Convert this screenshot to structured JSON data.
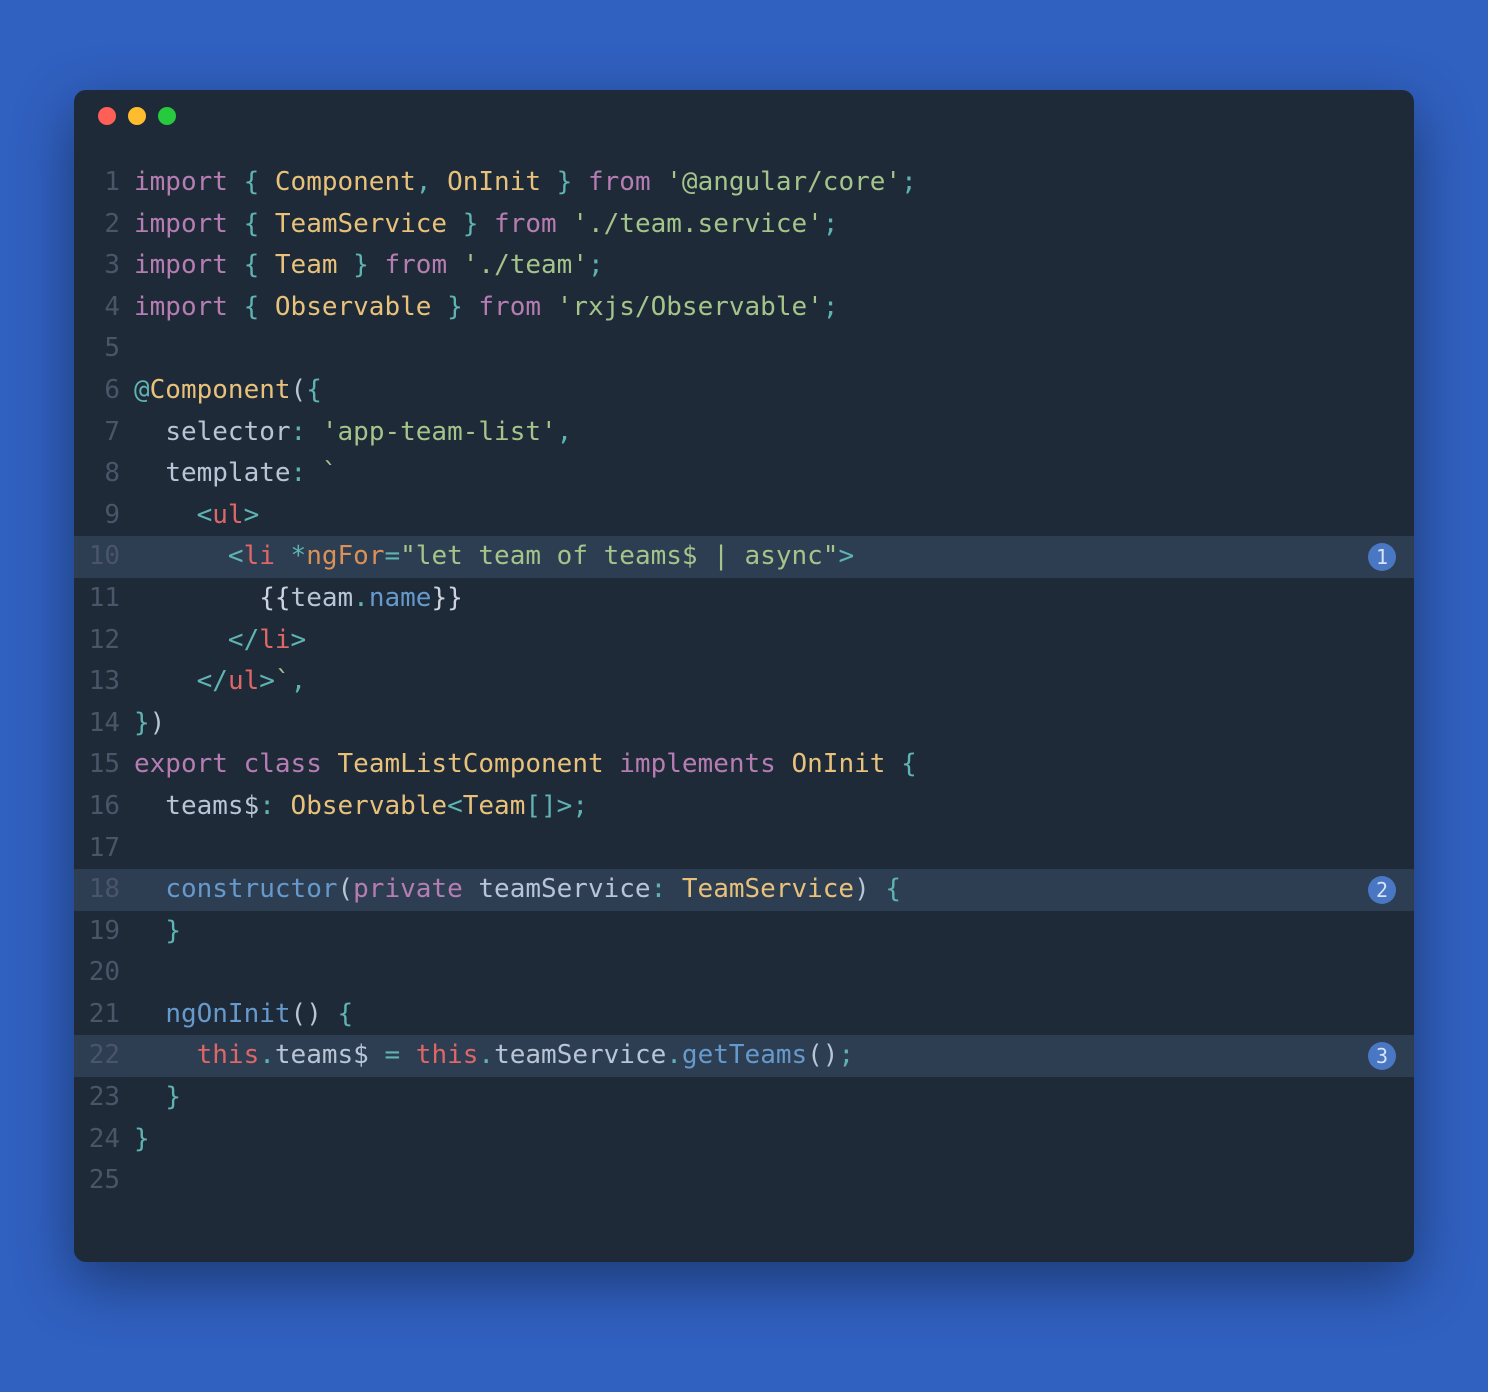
{
  "lines": [
    {
      "num": "1",
      "highlighted": false,
      "badge": null,
      "tokens": [
        {
          "cls": "tok-keyword",
          "text": "import"
        },
        {
          "cls": "tok-default",
          "text": " "
        },
        {
          "cls": "tok-punct",
          "text": "{"
        },
        {
          "cls": "tok-default",
          "text": " "
        },
        {
          "cls": "tok-type",
          "text": "Component"
        },
        {
          "cls": "tok-punct",
          "text": ","
        },
        {
          "cls": "tok-default",
          "text": " "
        },
        {
          "cls": "tok-type",
          "text": "OnInit"
        },
        {
          "cls": "tok-default",
          "text": " "
        },
        {
          "cls": "tok-punct",
          "text": "}"
        },
        {
          "cls": "tok-default",
          "text": " "
        },
        {
          "cls": "tok-keyword",
          "text": "from"
        },
        {
          "cls": "tok-default",
          "text": " "
        },
        {
          "cls": "tok-string",
          "text": "'@angular/core'"
        },
        {
          "cls": "tok-punct",
          "text": ";"
        }
      ]
    },
    {
      "num": "2",
      "highlighted": false,
      "badge": null,
      "tokens": [
        {
          "cls": "tok-keyword",
          "text": "import"
        },
        {
          "cls": "tok-default",
          "text": " "
        },
        {
          "cls": "tok-punct",
          "text": "{"
        },
        {
          "cls": "tok-default",
          "text": " "
        },
        {
          "cls": "tok-type",
          "text": "TeamService"
        },
        {
          "cls": "tok-default",
          "text": " "
        },
        {
          "cls": "tok-punct",
          "text": "}"
        },
        {
          "cls": "tok-default",
          "text": " "
        },
        {
          "cls": "tok-keyword",
          "text": "from"
        },
        {
          "cls": "tok-default",
          "text": " "
        },
        {
          "cls": "tok-string",
          "text": "'./team.service'"
        },
        {
          "cls": "tok-punct",
          "text": ";"
        }
      ]
    },
    {
      "num": "3",
      "highlighted": false,
      "badge": null,
      "tokens": [
        {
          "cls": "tok-keyword",
          "text": "import"
        },
        {
          "cls": "tok-default",
          "text": " "
        },
        {
          "cls": "tok-punct",
          "text": "{"
        },
        {
          "cls": "tok-default",
          "text": " "
        },
        {
          "cls": "tok-type",
          "text": "Team"
        },
        {
          "cls": "tok-default",
          "text": " "
        },
        {
          "cls": "tok-punct",
          "text": "}"
        },
        {
          "cls": "tok-default",
          "text": " "
        },
        {
          "cls": "tok-keyword",
          "text": "from"
        },
        {
          "cls": "tok-default",
          "text": " "
        },
        {
          "cls": "tok-string",
          "text": "'./team'"
        },
        {
          "cls": "tok-punct",
          "text": ";"
        }
      ]
    },
    {
      "num": "4",
      "highlighted": false,
      "badge": null,
      "tokens": [
        {
          "cls": "tok-keyword",
          "text": "import"
        },
        {
          "cls": "tok-default",
          "text": " "
        },
        {
          "cls": "tok-punct",
          "text": "{"
        },
        {
          "cls": "tok-default",
          "text": " "
        },
        {
          "cls": "tok-type",
          "text": "Observable"
        },
        {
          "cls": "tok-default",
          "text": " "
        },
        {
          "cls": "tok-punct",
          "text": "}"
        },
        {
          "cls": "tok-default",
          "text": " "
        },
        {
          "cls": "tok-keyword",
          "text": "from"
        },
        {
          "cls": "tok-default",
          "text": " "
        },
        {
          "cls": "tok-string",
          "text": "'rxjs/Observable'"
        },
        {
          "cls": "tok-punct",
          "text": ";"
        }
      ]
    },
    {
      "num": "5",
      "highlighted": false,
      "badge": null,
      "tokens": []
    },
    {
      "num": "6",
      "highlighted": false,
      "badge": null,
      "tokens": [
        {
          "cls": "tok-decorator",
          "text": "@"
        },
        {
          "cls": "tok-type",
          "text": "Component"
        },
        {
          "cls": "tok-punct2",
          "text": "("
        },
        {
          "cls": "tok-punct",
          "text": "{"
        }
      ]
    },
    {
      "num": "7",
      "highlighted": false,
      "badge": null,
      "tokens": [
        {
          "cls": "tok-default",
          "text": "  "
        },
        {
          "cls": "tok-default",
          "text": "selector"
        },
        {
          "cls": "tok-punct",
          "text": ":"
        },
        {
          "cls": "tok-default",
          "text": " "
        },
        {
          "cls": "tok-string",
          "text": "'app-team-list'"
        },
        {
          "cls": "tok-punct",
          "text": ","
        }
      ]
    },
    {
      "num": "8",
      "highlighted": false,
      "badge": null,
      "tokens": [
        {
          "cls": "tok-default",
          "text": "  "
        },
        {
          "cls": "tok-default",
          "text": "template"
        },
        {
          "cls": "tok-punct",
          "text": ":"
        },
        {
          "cls": "tok-default",
          "text": " "
        },
        {
          "cls": "tok-string",
          "text": "`"
        }
      ]
    },
    {
      "num": "9",
      "highlighted": false,
      "badge": null,
      "tokens": [
        {
          "cls": "tok-string",
          "text": "    "
        },
        {
          "cls": "tok-punct",
          "text": "<"
        },
        {
          "cls": "tok-tag",
          "text": "ul"
        },
        {
          "cls": "tok-punct",
          "text": ">"
        }
      ]
    },
    {
      "num": "10",
      "highlighted": true,
      "badge": "1",
      "tokens": [
        {
          "cls": "tok-string",
          "text": "      "
        },
        {
          "cls": "tok-punct",
          "text": "<"
        },
        {
          "cls": "tok-tag",
          "text": "li"
        },
        {
          "cls": "tok-default",
          "text": " "
        },
        {
          "cls": "tok-punct",
          "text": "*"
        },
        {
          "cls": "tok-attr",
          "text": "ngFor"
        },
        {
          "cls": "tok-punct",
          "text": "="
        },
        {
          "cls": "tok-string",
          "text": "\"let team of teams$ | async\""
        },
        {
          "cls": "tok-punct",
          "text": ">"
        }
      ]
    },
    {
      "num": "11",
      "highlighted": false,
      "badge": null,
      "tokens": [
        {
          "cls": "tok-string",
          "text": "        "
        },
        {
          "cls": "tok-light",
          "text": "{{"
        },
        {
          "cls": "tok-default",
          "text": "team"
        },
        {
          "cls": "tok-punct",
          "text": "."
        },
        {
          "cls": "tok-method",
          "text": "name"
        },
        {
          "cls": "tok-light",
          "text": "}}"
        }
      ]
    },
    {
      "num": "12",
      "highlighted": false,
      "badge": null,
      "tokens": [
        {
          "cls": "tok-string",
          "text": "      "
        },
        {
          "cls": "tok-punct",
          "text": "</"
        },
        {
          "cls": "tok-tag",
          "text": "li"
        },
        {
          "cls": "tok-punct",
          "text": ">"
        }
      ]
    },
    {
      "num": "13",
      "highlighted": false,
      "badge": null,
      "tokens": [
        {
          "cls": "tok-string",
          "text": "    "
        },
        {
          "cls": "tok-punct",
          "text": "</"
        },
        {
          "cls": "tok-tag",
          "text": "ul"
        },
        {
          "cls": "tok-punct",
          "text": ">"
        },
        {
          "cls": "tok-string",
          "text": "`"
        },
        {
          "cls": "tok-punct",
          "text": ","
        }
      ]
    },
    {
      "num": "14",
      "highlighted": false,
      "badge": null,
      "tokens": [
        {
          "cls": "tok-punct",
          "text": "}"
        },
        {
          "cls": "tok-punct2",
          "text": ")"
        }
      ]
    },
    {
      "num": "15",
      "highlighted": false,
      "badge": null,
      "tokens": [
        {
          "cls": "tok-keyword",
          "text": "export"
        },
        {
          "cls": "tok-default",
          "text": " "
        },
        {
          "cls": "tok-keyword",
          "text": "class"
        },
        {
          "cls": "tok-default",
          "text": " "
        },
        {
          "cls": "tok-type",
          "text": "TeamListComponent"
        },
        {
          "cls": "tok-default",
          "text": " "
        },
        {
          "cls": "tok-keyword",
          "text": "implements"
        },
        {
          "cls": "tok-default",
          "text": " "
        },
        {
          "cls": "tok-type",
          "text": "OnInit"
        },
        {
          "cls": "tok-default",
          "text": " "
        },
        {
          "cls": "tok-punct",
          "text": "{"
        }
      ]
    },
    {
      "num": "16",
      "highlighted": false,
      "badge": null,
      "tokens": [
        {
          "cls": "tok-default",
          "text": "  teams$"
        },
        {
          "cls": "tok-punct",
          "text": ":"
        },
        {
          "cls": "tok-default",
          "text": " "
        },
        {
          "cls": "tok-type",
          "text": "Observable"
        },
        {
          "cls": "tok-punct",
          "text": "<"
        },
        {
          "cls": "tok-type",
          "text": "Team"
        },
        {
          "cls": "tok-punct",
          "text": "[]>;"
        }
      ]
    },
    {
      "num": "17",
      "highlighted": false,
      "badge": null,
      "tokens": []
    },
    {
      "num": "18",
      "highlighted": true,
      "badge": "2",
      "tokens": [
        {
          "cls": "tok-default",
          "text": "  "
        },
        {
          "cls": "tok-method",
          "text": "constructor"
        },
        {
          "cls": "tok-punct2",
          "text": "("
        },
        {
          "cls": "tok-keyword",
          "text": "private"
        },
        {
          "cls": "tok-default",
          "text": " teamService"
        },
        {
          "cls": "tok-punct",
          "text": ":"
        },
        {
          "cls": "tok-default",
          "text": " "
        },
        {
          "cls": "tok-type",
          "text": "TeamService"
        },
        {
          "cls": "tok-punct2",
          "text": ")"
        },
        {
          "cls": "tok-default",
          "text": " "
        },
        {
          "cls": "tok-punct",
          "text": "{"
        }
      ]
    },
    {
      "num": "19",
      "highlighted": false,
      "badge": null,
      "tokens": [
        {
          "cls": "tok-default",
          "text": "  "
        },
        {
          "cls": "tok-punct",
          "text": "}"
        }
      ]
    },
    {
      "num": "20",
      "highlighted": false,
      "badge": null,
      "tokens": []
    },
    {
      "num": "21",
      "highlighted": false,
      "badge": null,
      "tokens": [
        {
          "cls": "tok-default",
          "text": "  "
        },
        {
          "cls": "tok-method",
          "text": "ngOnInit"
        },
        {
          "cls": "tok-punct2",
          "text": "()"
        },
        {
          "cls": "tok-default",
          "text": " "
        },
        {
          "cls": "tok-punct",
          "text": "{"
        }
      ]
    },
    {
      "num": "22",
      "highlighted": true,
      "badge": "3",
      "tokens": [
        {
          "cls": "tok-default",
          "text": "    "
        },
        {
          "cls": "tok-this",
          "text": "this"
        },
        {
          "cls": "tok-punct",
          "text": "."
        },
        {
          "cls": "tok-default",
          "text": "teams$ "
        },
        {
          "cls": "tok-punct",
          "text": "="
        },
        {
          "cls": "tok-default",
          "text": " "
        },
        {
          "cls": "tok-this",
          "text": "this"
        },
        {
          "cls": "tok-punct",
          "text": "."
        },
        {
          "cls": "tok-default",
          "text": "teamService"
        },
        {
          "cls": "tok-punct",
          "text": "."
        },
        {
          "cls": "tok-method",
          "text": "getTeams"
        },
        {
          "cls": "tok-punct2",
          "text": "()"
        },
        {
          "cls": "tok-punct",
          "text": ";"
        }
      ]
    },
    {
      "num": "23",
      "highlighted": false,
      "badge": null,
      "tokens": [
        {
          "cls": "tok-default",
          "text": "  "
        },
        {
          "cls": "tok-punct",
          "text": "}"
        }
      ]
    },
    {
      "num": "24",
      "highlighted": false,
      "badge": null,
      "tokens": [
        {
          "cls": "tok-punct",
          "text": "}"
        }
      ]
    },
    {
      "num": "25",
      "highlighted": false,
      "badge": null,
      "tokens": []
    }
  ]
}
